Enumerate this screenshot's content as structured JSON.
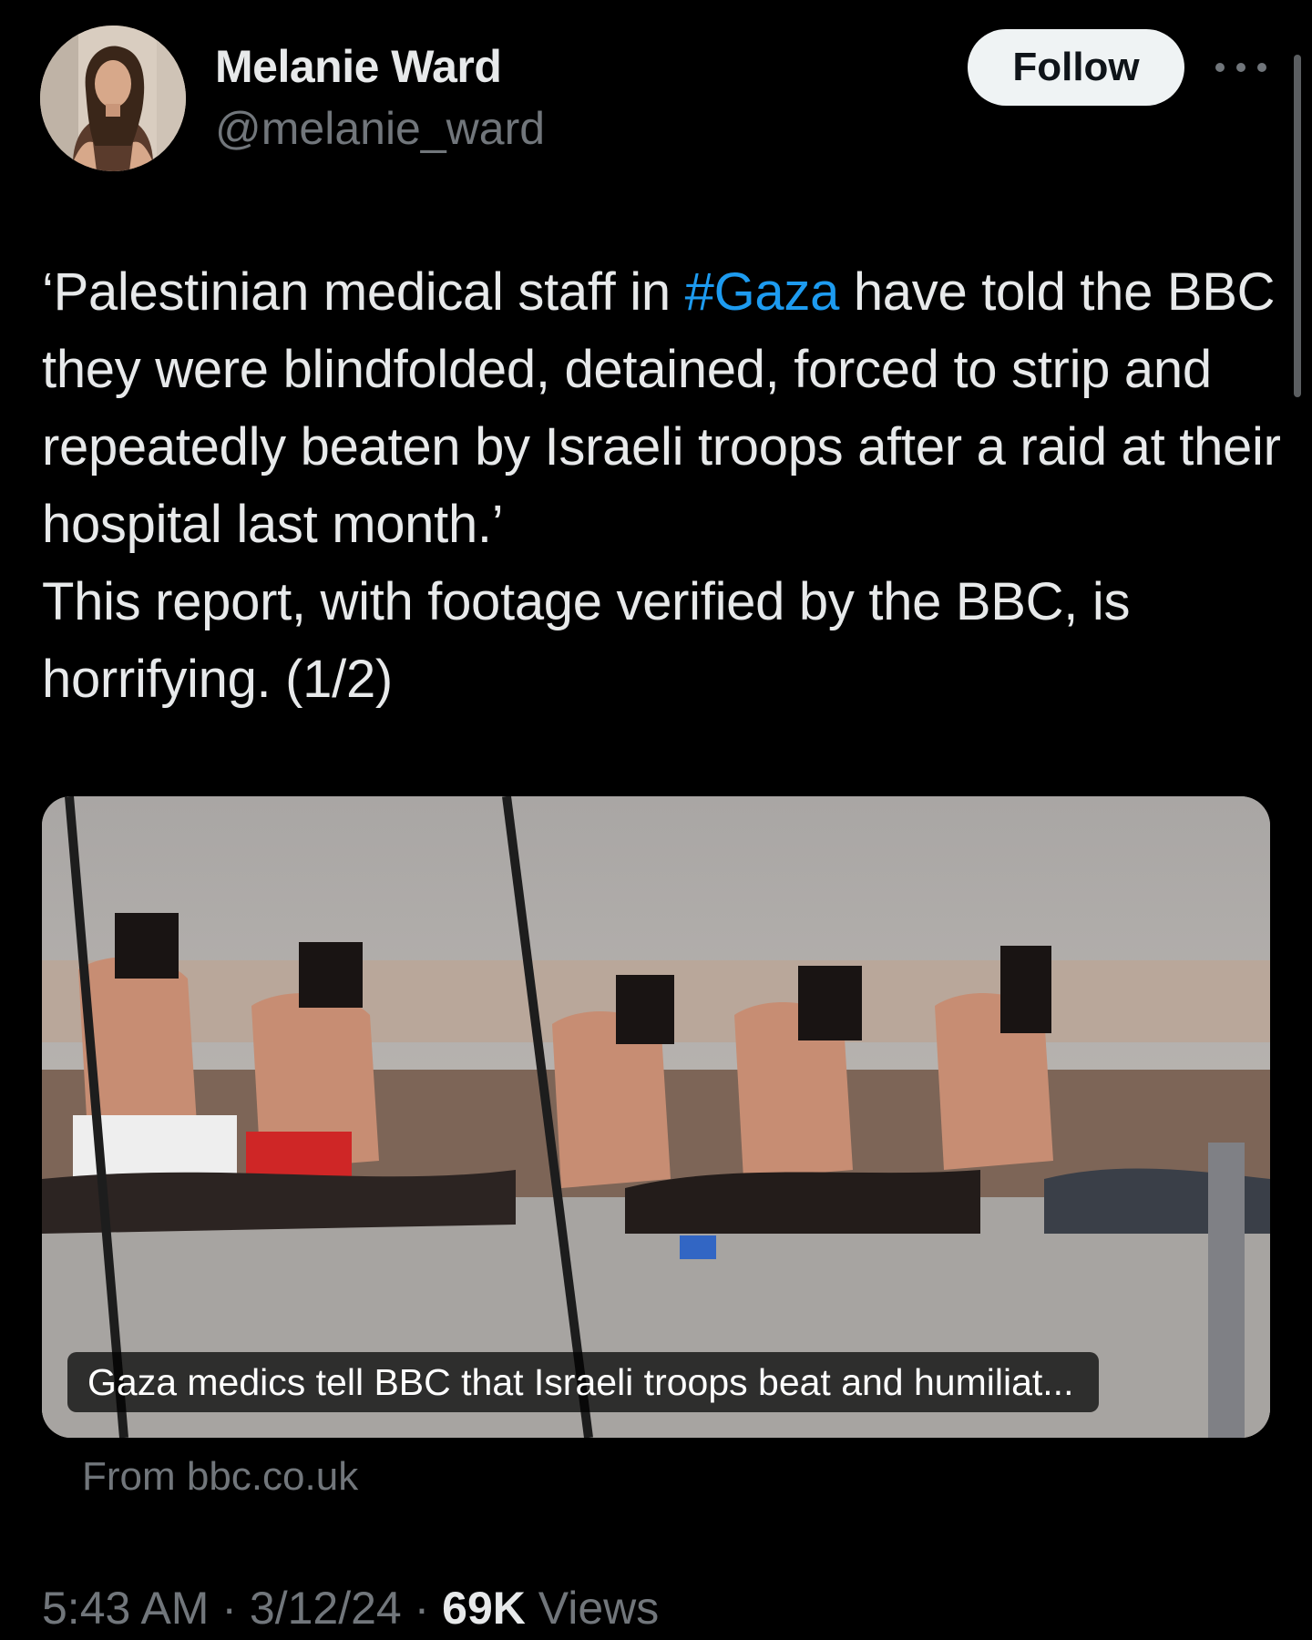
{
  "author": {
    "display_name": "Melanie Ward",
    "handle": "@melanie_ward"
  },
  "actions": {
    "follow_label": "Follow"
  },
  "tweet": {
    "text_before_hashtag": "‘Palestinian medical staff in ",
    "hashtag": "#Gaza",
    "text_after_hashtag": " have told the BBC they were blindfolded, detained, forced to strip and repeatedly beaten by Israeli troops after a raid at their hospital last month.’",
    "text_line2": "This report, with footage verified by the BBC, is horrifying. (1/2)"
  },
  "link_card": {
    "caption": "Gaza medics tell BBC that Israeli troops beat and humiliat...",
    "source": "From bbc.co.uk"
  },
  "meta": {
    "time": "5:43 AM",
    "separator": " · ",
    "date": "3/12/24",
    "views_count": "69K",
    "views_label": " Views"
  },
  "colors": {
    "background": "#000000",
    "text": "#e7e9ea",
    "secondary_text": "#71767b",
    "link": "#1d9bf0",
    "follow_button_bg": "#eff3f4"
  }
}
